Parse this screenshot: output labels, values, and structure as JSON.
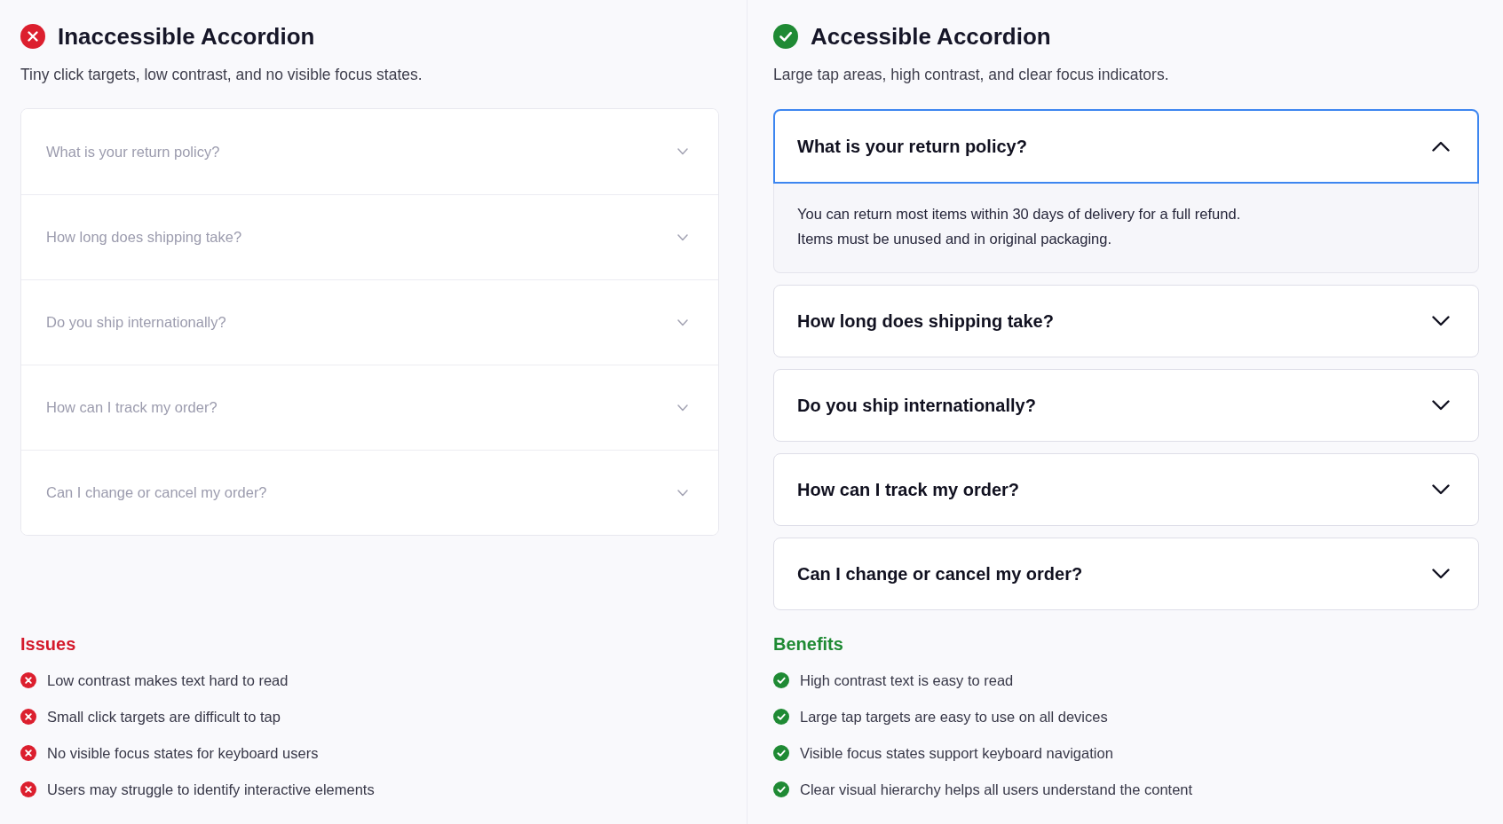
{
  "panels": [
    {
      "kind": "inaccessible",
      "title": "Inaccessible Accordion",
      "subtitle": "Tiny click targets, low contrast, and no visible focus states.",
      "accordion": [
        {
          "question": "What is your return policy?",
          "expanded": false
        },
        {
          "question": "How long does shipping take?",
          "expanded": false
        },
        {
          "question": "Do you ship internationally?",
          "expanded": false
        },
        {
          "question": "How can I track my order?",
          "expanded": false
        },
        {
          "question": "Can I change or cancel my order?",
          "expanded": false
        }
      ],
      "list_title": "Issues",
      "list_items": [
        "Low contrast makes text hard to read",
        "Small click targets are difficult to tap",
        "No visible focus states for keyboard users",
        "Users may struggle to identify interactive elements"
      ]
    },
    {
      "kind": "accessible",
      "title": "Accessible Accordion",
      "subtitle": "Large tap areas, high contrast, and clear focus indicators.",
      "accordion": [
        {
          "question": "What is your return policy?",
          "expanded": true,
          "focused": true,
          "answer": [
            "You can return most items within 30 days of delivery for a full refund.",
            "Items must be unused and in original packaging."
          ]
        },
        {
          "question": "How long does shipping take?",
          "expanded": false,
          "focused": false
        },
        {
          "question": "Do you ship internationally?",
          "expanded": false,
          "focused": false
        },
        {
          "question": "How can I track my order?",
          "expanded": false,
          "focused": false
        },
        {
          "question": "Can I change or cancel my order?",
          "expanded": false,
          "focused": false
        }
      ],
      "list_title": "Benefits",
      "list_items": [
        "High contrast text is easy to read",
        "Large tap targets are easy to use on all devices",
        "Visible focus states support keyboard navigation",
        "Clear visual hierarchy helps all users understand the content"
      ]
    }
  ]
}
